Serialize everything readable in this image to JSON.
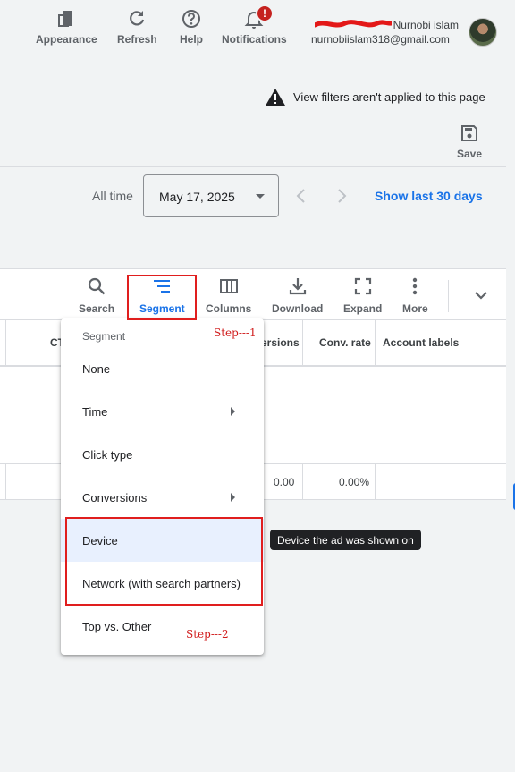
{
  "header": {
    "toolbar": [
      {
        "label": "Appearance",
        "icon": "appearance-icon"
      },
      {
        "label": "Refresh",
        "icon": "refresh-icon"
      },
      {
        "label": "Help",
        "icon": "help-icon"
      },
      {
        "label": "Notifications",
        "icon": "bell-icon"
      }
    ],
    "notification_badge": "!",
    "user_name": "Nurnobi islam",
    "user_email": "nurnobiislam318@gmail.com"
  },
  "notice": {
    "text": "View filters aren't applied to this page",
    "save_label": "Save"
  },
  "date_range": {
    "label": "All time",
    "value": "May 17, 2025",
    "show_last": "Show last 30 days"
  },
  "table_toolbar": [
    {
      "label": "Search",
      "icon": "search-icon"
    },
    {
      "label": "Segment",
      "icon": "segment-icon",
      "active": true
    },
    {
      "label": "Columns",
      "icon": "columns-icon"
    },
    {
      "label": "Download",
      "icon": "download-icon"
    },
    {
      "label": "Expand",
      "icon": "expand-icon"
    },
    {
      "label": "More",
      "icon": "more-vert-icon"
    }
  ],
  "table": {
    "columns": [
      "CT",
      "ersions",
      "Conv. rate",
      "Account labels"
    ],
    "total_row": [
      "0.00",
      "0.00%"
    ]
  },
  "segment_menu": {
    "header": "Segment",
    "items": [
      {
        "label": "None",
        "submenu": false
      },
      {
        "label": "Time",
        "submenu": true
      },
      {
        "label": "Click type",
        "submenu": false
      },
      {
        "label": "Conversions",
        "submenu": true
      },
      {
        "label": "Device",
        "submenu": false,
        "highlighted": true
      },
      {
        "label": "Network (with search partners)",
        "submenu": false
      },
      {
        "label": "Top vs. Other",
        "submenu": false
      }
    ]
  },
  "tooltip": "Device the ad was shown on",
  "annotations": {
    "step1": "Step---1",
    "step2": "Step---2"
  },
  "colors": {
    "accent": "#1a73e8",
    "annotation": "#e01e1e",
    "highlight": "#e8f0fe",
    "badge": "#c5221f"
  }
}
